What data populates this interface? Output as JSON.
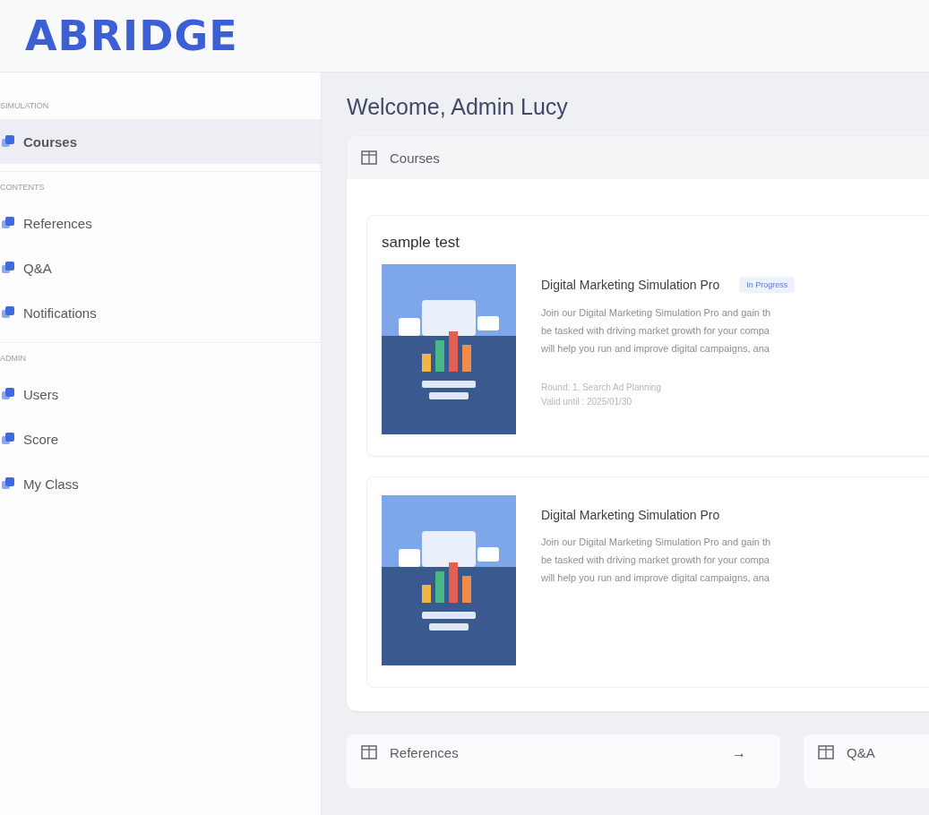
{
  "header": {
    "logo": "ABRIDGE"
  },
  "sidebar": {
    "sections": [
      {
        "label": "SIMULATION",
        "items": [
          {
            "label": "Courses",
            "selected": true
          }
        ]
      },
      {
        "label": "CONTENTS",
        "items": [
          {
            "label": "References",
            "selected": false
          },
          {
            "label": "Q&A",
            "selected": false
          },
          {
            "label": "Notifications",
            "selected": false
          }
        ]
      },
      {
        "label": "ADMIN",
        "items": [
          {
            "label": "Users",
            "selected": false
          },
          {
            "label": "Score",
            "selected": false
          },
          {
            "label": "My Class",
            "selected": false
          }
        ]
      }
    ]
  },
  "main": {
    "welcome": "Welcome, Admin Lucy",
    "courses_panel": {
      "title": "Courses",
      "groups": [
        {
          "title": "sample test",
          "course": {
            "name": "Digital Marketing Simulation Pro",
            "status": "In Progress",
            "description": [
              "Join our Digital Marketing Simulation Pro and gain th",
              "be tasked with driving market growth for your compa",
              "will help you run and improve digital campaigns, ana"
            ],
            "meta": [
              "Round: 1. Search Ad Planning",
              "Valid until : 2025/01/30"
            ]
          }
        },
        {
          "course": {
            "name": "Digital Marketing Simulation Pro",
            "description": [
              "Join our Digital Marketing Simulation Pro and gain th",
              "be tasked with driving market growth for your compa",
              "will help you run and improve digital campaigns, ana"
            ]
          }
        }
      ]
    },
    "bottom_panels": [
      {
        "title": "References",
        "arrow": "→"
      },
      {
        "title": "Q&A"
      }
    ]
  }
}
